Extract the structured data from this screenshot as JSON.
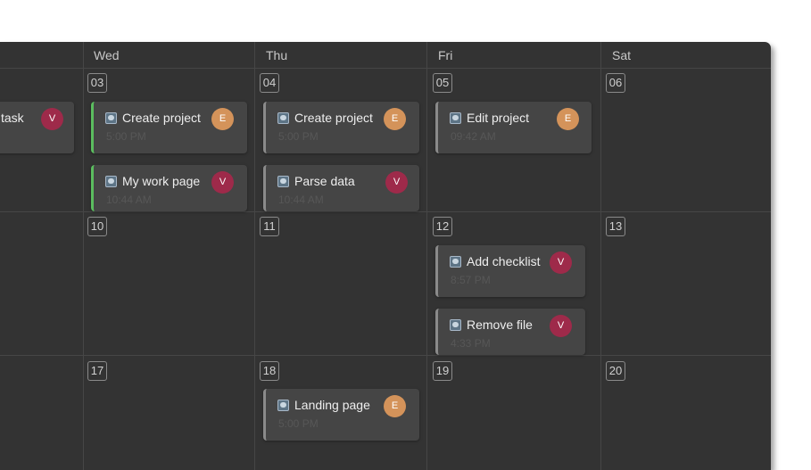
{
  "header": {
    "days": [
      "Wed",
      "Thu",
      "Fri",
      "Sat"
    ]
  },
  "weeks": [
    {
      "days": [
        "03",
        "04",
        "05",
        "06"
      ]
    },
    {
      "days": [
        "10",
        "11",
        "12",
        "13"
      ]
    },
    {
      "days": [
        "17",
        "18",
        "19",
        "20"
      ]
    }
  ],
  "events": {
    "tue_task": {
      "title": "task",
      "avatar": "V"
    },
    "wed_create_project": {
      "title": "Create project",
      "time": "5:00 PM",
      "avatar": "E"
    },
    "wed_my_work_page": {
      "title": "My work page",
      "time": "10:44 AM",
      "avatar": "V"
    },
    "thu_create_project": {
      "title": "Create project",
      "time": "5:00 PM",
      "avatar": "E"
    },
    "thu_parse_data": {
      "title": "Parse data",
      "time": "10:44 AM",
      "avatar": "V"
    },
    "fri_edit_project": {
      "title": "Edit project",
      "time": "09:42 AM",
      "avatar": "E"
    },
    "fri_add_checklist": {
      "title": "Add checklist",
      "time": "8:57 PM",
      "avatar": "V"
    },
    "fri_remove_file": {
      "title": "Remove file",
      "time": "4:33 PM",
      "avatar": "V"
    },
    "thu_landing_page": {
      "title": "Landing page",
      "time": "5:00 PM",
      "avatar": "E"
    }
  },
  "colors": {
    "background": "#333333",
    "event_card": "#454545",
    "accent_green": "#5bbd5f",
    "avatar_v": "#9e2a4a",
    "avatar_e": "#d4935a"
  },
  "icons": {
    "event": "task-icon"
  }
}
